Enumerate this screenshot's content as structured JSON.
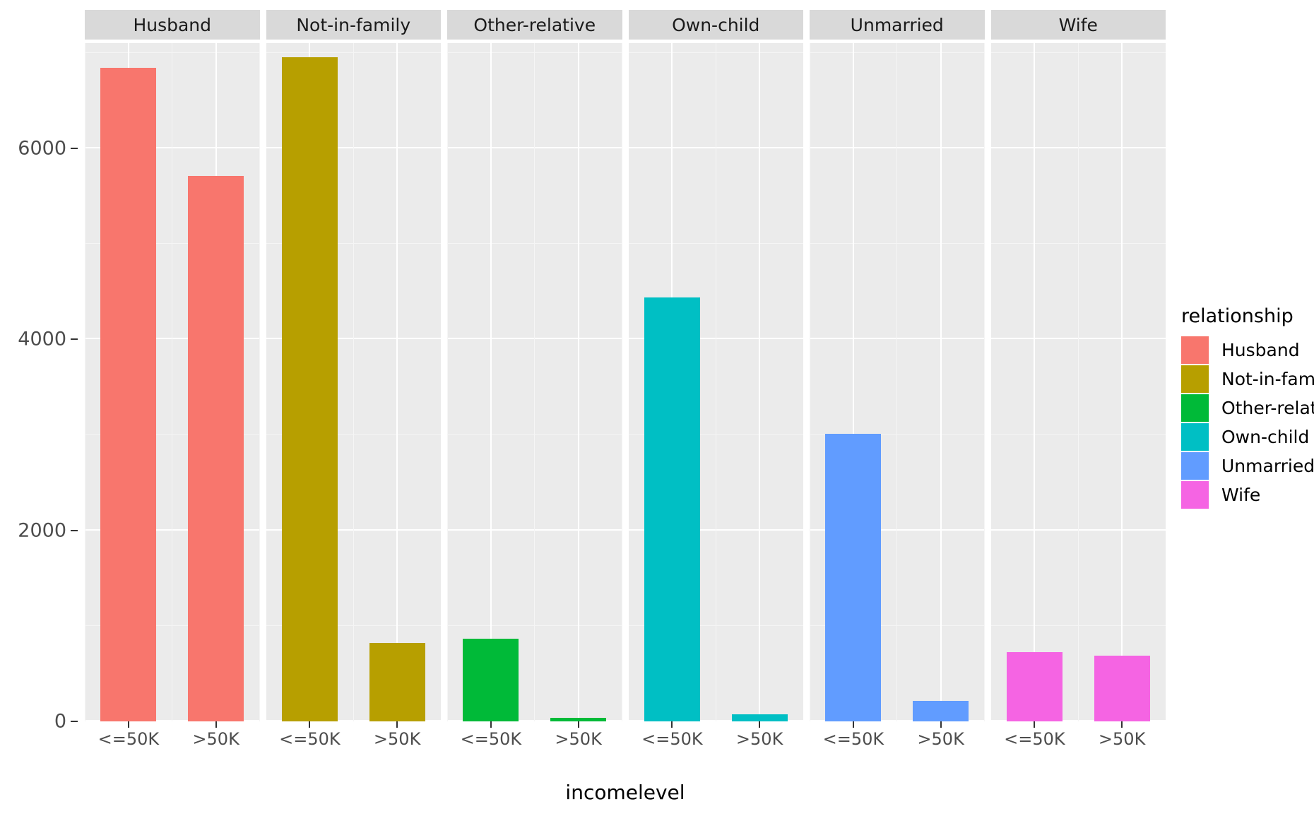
{
  "chart_data": {
    "type": "bar",
    "title": "",
    "subtitle": "",
    "xlabel": "incomelevel",
    "ylabel": "",
    "categories": [
      "<=50K",
      ">50K"
    ],
    "facet_variable": "relationship",
    "facets": [
      {
        "label": "Husband",
        "color": "#F8766D",
        "values": [
          6840,
          5712
        ]
      },
      {
        "label": "Not-in-family",
        "color": "#B79F00",
        "values": [
          6950,
          820
        ]
      },
      {
        "label": "Other-relative",
        "color": "#00BA38",
        "values": [
          865,
          37
        ]
      },
      {
        "label": "Own-child",
        "color": "#00BFC4",
        "values": [
          4435,
          74
        ]
      },
      {
        "label": "Unmarried",
        "color": "#619CFF",
        "values": [
          3010,
          215
        ]
      },
      {
        "label": "Wife",
        "color": "#F564E3",
        "values": [
          723,
          686
        ]
      }
    ],
    "ylim": [
      0,
      7100
    ],
    "y_ticks": [
      0,
      2000,
      4000,
      6000
    ],
    "y_tick_labels": [
      "0",
      "2000",
      "4000",
      "6000"
    ],
    "y_minor_ticks": [
      1000,
      3000,
      5000,
      7000
    ],
    "grid": true,
    "legend_position": "right",
    "legend": {
      "title": "relationship",
      "entries": [
        {
          "label": "Husband",
          "color": "#F8766D"
        },
        {
          "label": "Not-in-family",
          "color": "#B79F00"
        },
        {
          "label": "Other-relative",
          "color": "#00BA38"
        },
        {
          "label": "Own-child",
          "color": "#00BFC4"
        },
        {
          "label": "Unmarried",
          "color": "#619CFF"
        },
        {
          "label": "Wife",
          "color": "#F564E3"
        }
      ]
    },
    "theme": {
      "panel_background": "#EBEBEB",
      "strip_background": "#D9D9D9",
      "gridline_major": "#FFFFFF",
      "plot_background": "#FFFFFF"
    }
  }
}
